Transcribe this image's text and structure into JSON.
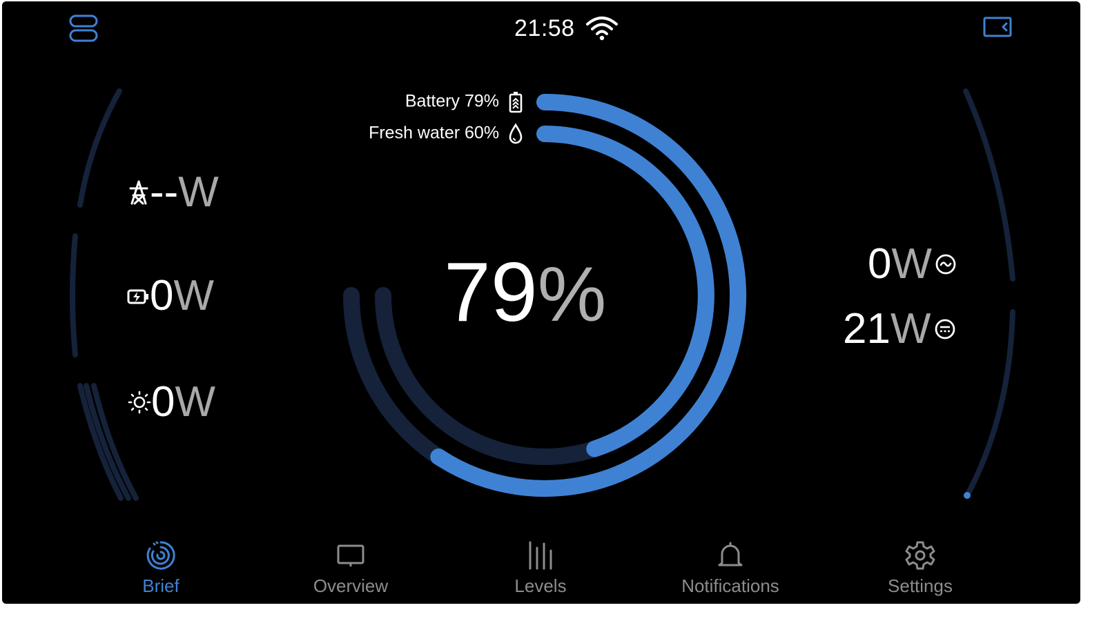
{
  "status_bar": {
    "time": "21:58"
  },
  "colors": {
    "accent": "#3f82d4",
    "track": "#15223a",
    "background": "#000000"
  },
  "sources": {
    "grid": {
      "value": "--",
      "unit": "W",
      "icon": "power-tower-icon"
    },
    "charger": {
      "value": "0",
      "unit": "W",
      "icon": "charger-icon"
    },
    "solar": {
      "value": "0",
      "unit": "W",
      "icon": "sun-icon"
    }
  },
  "loads": {
    "ac": {
      "value": "0",
      "unit": "W",
      "icon": "ac-load-icon"
    },
    "dc": {
      "value": "21",
      "unit": "W",
      "icon": "dc-load-icon"
    }
  },
  "center": {
    "value": "79",
    "unit": "%"
  },
  "gauges": {
    "battery": {
      "label": "Battery 79%",
      "level": 0.79
    },
    "fresh_water": {
      "label": "Fresh water 60%",
      "level": 0.6
    }
  },
  "tabs": [
    {
      "label": "Brief",
      "icon": "brief-icon",
      "active": true
    },
    {
      "label": "Overview",
      "icon": "overview-icon",
      "active": false
    },
    {
      "label": "Levels",
      "icon": "levels-icon",
      "active": false
    },
    {
      "label": "Notifications",
      "icon": "bell-icon",
      "active": false
    },
    {
      "label": "Settings",
      "icon": "gear-icon",
      "active": false
    }
  ]
}
